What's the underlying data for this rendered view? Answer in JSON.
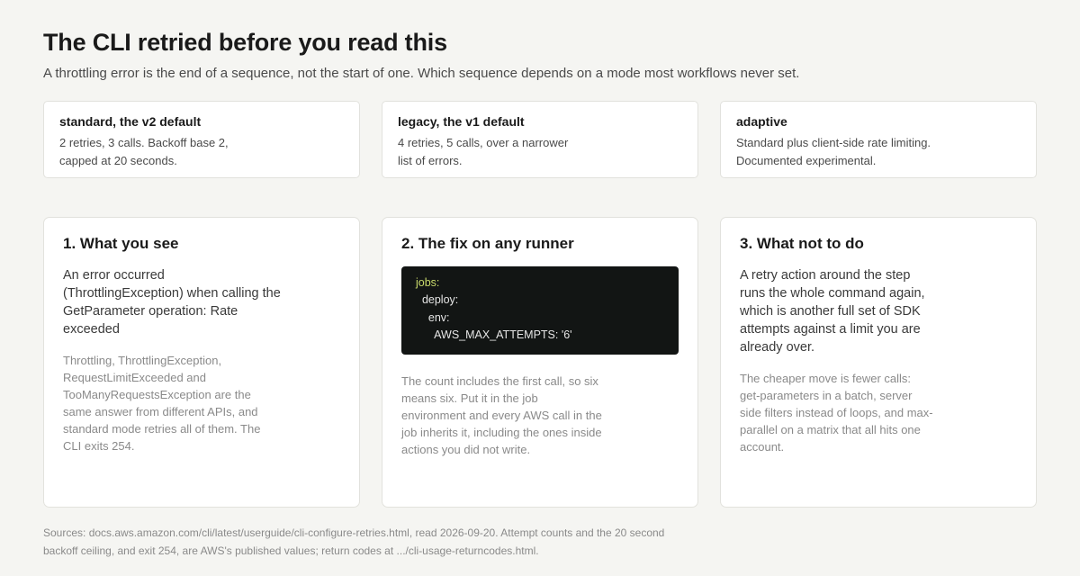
{
  "header": {
    "title": "The CLI retried before you read this",
    "subtitle": "A throttling error is the end of a sequence, not the start of one. Which sequence depends on a mode most workflows never set."
  },
  "modes": [
    {
      "name": "standard, the v2 default",
      "desc": "2 retries, 3 calls. Backoff base 2, capped at 20 seconds."
    },
    {
      "name": "legacy, the v1 default",
      "desc": "4 retries, 5 calls, over a narrower list of errors."
    },
    {
      "name": "adaptive",
      "desc": "Standard plus client-side rate limiting. Documented experimental."
    }
  ],
  "panels": {
    "see": {
      "title": "1. What you see",
      "lead": "An error occurred (ThrottlingException) when calling the GetParameter operation: Rate exceeded",
      "note": "Throttling, ThrottlingException, RequestLimitExceeded and TooManyRequestsException are the same answer from different APIs, and standard mode retries all of them. The CLI exits 254."
    },
    "fix": {
      "title": "2. The fix on any runner",
      "code": [
        "jobs:",
        "  deploy:",
        "    env:",
        "      AWS_MAX_ATTEMPTS: '6'"
      ],
      "note": "The count includes the first call, so six means six. Put it in the job environment and every AWS call in the job inherits it, including the ones inside actions you did not write."
    },
    "avoid": {
      "title": "3. What not to do",
      "lead": "A retry action around the step runs the whole command again, which is another full set of SDK attempts against a limit you are already over.",
      "note": "The cheaper move is fewer calls: get-parameters in a batch, server side filters instead of loops, and max-parallel on a matrix that all hits one account."
    }
  },
  "footer": {
    "sources": "Sources: docs.aws.amazon.com/cli/latest/userguide/cli-configure-retries.html, read 2026-09-20. Attempt counts and the 20 second backoff ceiling, and exit 254, are AWS's published values; return codes at .../cli-usage-returncodes.html."
  },
  "colors": {
    "background": "#f5f5f2",
    "card": "#ffffff",
    "code_background": "#121514",
    "code_keyword": "#c8d96b"
  }
}
